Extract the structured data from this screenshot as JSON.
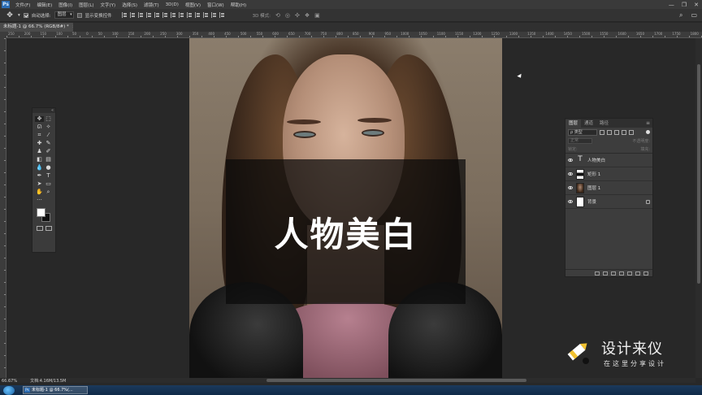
{
  "menubar": {
    "items": [
      "文件(F)",
      "编辑(E)",
      "图像(I)",
      "图层(L)",
      "文字(Y)",
      "选择(S)",
      "滤镜(T)",
      "3D(D)",
      "视图(V)",
      "窗口(W)",
      "帮助(H)"
    ],
    "window_controls": [
      "—",
      "❐",
      "✕"
    ]
  },
  "options_bar": {
    "auto_select_label": "自动选择:",
    "auto_select_value": "图层",
    "show_transform_label": "显示变换控件",
    "mode_3d_label": "3D 模式:"
  },
  "document_tab": {
    "title": "未标题-1 @ 66.7% (RGB/8#) *",
    "close": "×"
  },
  "ruler": {
    "ticks": [
      "250",
      "200",
      "150",
      "100",
      "50",
      "0",
      "50",
      "100",
      "150",
      "200",
      "250",
      "300",
      "350",
      "400",
      "450",
      "500",
      "550",
      "600",
      "650",
      "700",
      "750",
      "800",
      "850",
      "900",
      "950",
      "1000",
      "1050",
      "1100",
      "1150",
      "1200",
      "1250",
      "1300",
      "1350",
      "1400",
      "1450",
      "1500",
      "1550",
      "1600",
      "1650",
      "1700",
      "1750",
      "1800"
    ]
  },
  "overlay_title": "人物美白",
  "layers_panel": {
    "tabs": [
      "图层",
      "通道",
      "路径"
    ],
    "filter_label": "ρ 类型",
    "blend_mode": "正常",
    "opacity_label": "不透明度:",
    "lock_label": "锁定:",
    "fill_label": "填充:",
    "layers": [
      {
        "name": "人物美白",
        "thumb": "T",
        "kind": "text"
      },
      {
        "name": "矩形 1",
        "thumb": "",
        "kind": "shape"
      },
      {
        "name": "图层 1",
        "thumb": "",
        "kind": "photo-t"
      },
      {
        "name": "背景",
        "thumb": "",
        "kind": "bg"
      }
    ]
  },
  "status": {
    "zoom": "66.67%",
    "doc_size": "文档:4.16M/13.5M"
  },
  "taskbar": {
    "item": "未标题-1 @ 66.7%(..."
  },
  "watermark": {
    "title": "设计来仪",
    "subtitle": "在这里分享设计"
  }
}
